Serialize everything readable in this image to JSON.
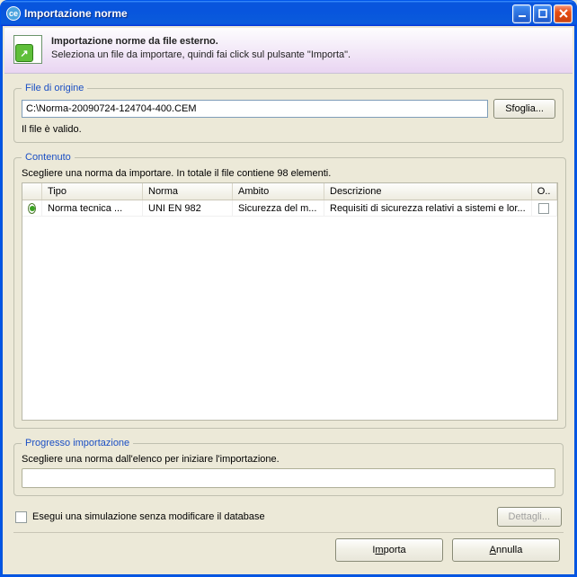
{
  "window": {
    "title": "Importazione norme",
    "app_icon_text": "ce"
  },
  "banner": {
    "line1": "Importazione norme da file esterno.",
    "line2": "Seleziona un file da importare, quindi fai click sul pulsante \"Importa\"."
  },
  "file_group": {
    "legend": "File di origine",
    "path": "C:\\Norma-20090724-124704-400.CEM",
    "browse_label": "Sfoglia...",
    "status": "Il file è valido."
  },
  "contenuto": {
    "legend": "Contenuto",
    "desc": "Scegliere una norma da importare. In totale il file contiene 98 elementi.",
    "columns": {
      "tipo": "Tipo",
      "norma": "Norma",
      "ambito": "Ambito",
      "descrizione": "Descrizione",
      "o": "O.."
    },
    "rows": [
      {
        "selected": true,
        "tipo": "Norma tecnica ...",
        "norma": "UNI EN 982",
        "ambito": "Sicurezza del m...",
        "descrizione": "Requisiti di sicurezza relativi a sistemi e lor...",
        "o_checked": false
      }
    ]
  },
  "progress": {
    "legend": "Progresso importazione",
    "text": "Scegliere una norma dall'elenco per iniziare l'importazione."
  },
  "simulation": {
    "label": "Esegui una simulazione senza modificare il database",
    "checked": false,
    "details_label": "Dettagli...",
    "details_enabled": false
  },
  "footer": {
    "import_pre": "I",
    "import_u": "m",
    "import_post": "porta",
    "cancel_pre": "",
    "cancel_u": "A",
    "cancel_post": "nnulla"
  }
}
